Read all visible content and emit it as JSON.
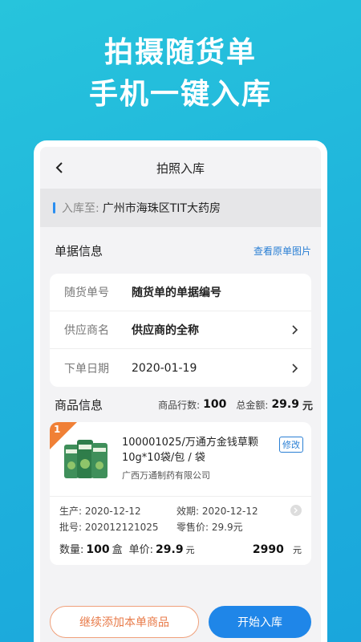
{
  "hero": {
    "line1": "拍摄随货单",
    "line2": "手机一键入库"
  },
  "nav": {
    "title": "拍照入库",
    "back_icon": "chevron-left-icon"
  },
  "destination": {
    "label": "入库至:",
    "value": "广州市海珠区TIT大药房"
  },
  "doc_info": {
    "title": "单据信息",
    "view_link": "查看原单图片",
    "rows": [
      {
        "label": "随货单号",
        "value": "随货单的单据编号"
      },
      {
        "label": "供应商名",
        "value": "供应商的全称"
      },
      {
        "label": "下单日期",
        "value": "2020-01-19"
      }
    ]
  },
  "goods": {
    "title": "商品信息",
    "rows_label": "商品行数:",
    "rows_value": "100",
    "amount_label": "总金额:",
    "amount_value": "29.9",
    "amount_unit": "元"
  },
  "product": {
    "index": "1",
    "name": "100001025/万通方金钱草颗10g*10袋/包 / 袋",
    "maker": "广西万通制药有限公司",
    "edit_label": "修改",
    "produce_label": "生产:",
    "produce_value": "2020-12-12",
    "expire_label": "效期:",
    "expire_value": "2020-12-12",
    "batch_label": "批号:",
    "batch_value": "202012121025",
    "retail_label": "零售价:",
    "retail_value": "29.9元",
    "qty_label": "数量:",
    "qty_value": "100",
    "qty_unit": "盒",
    "price_label": "单价:",
    "price_value": "29.9",
    "price_unit": "元",
    "total_value": "2990",
    "total_unit": "元"
  },
  "buttons": {
    "continue": "继续添加本单商品",
    "start": "开始入库"
  },
  "colors": {
    "accent": "#1f86e8",
    "orange": "#f08036",
    "bg": "#1fb3dc"
  }
}
